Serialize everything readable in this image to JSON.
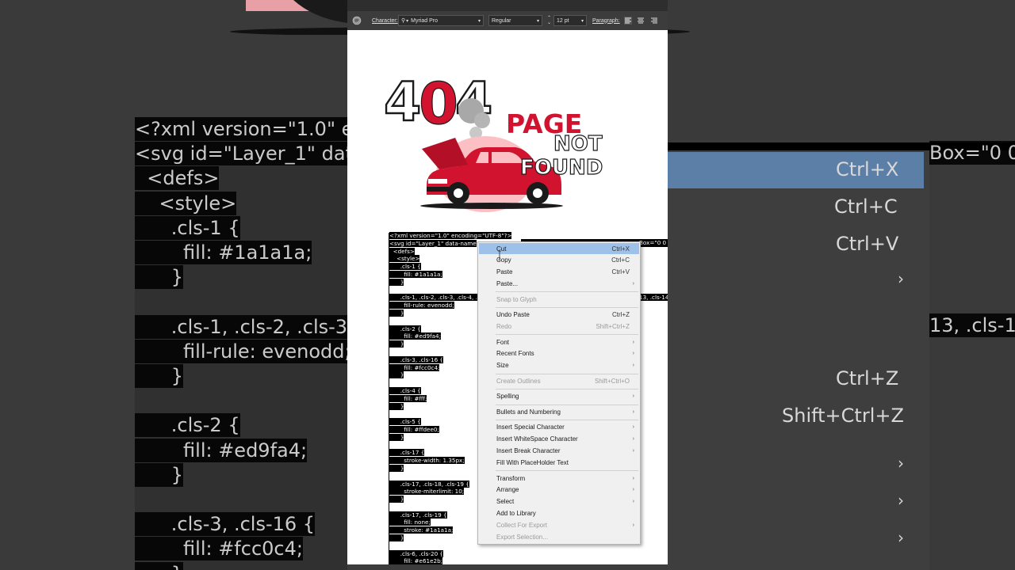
{
  "toolbar": {
    "character_label": "Character:",
    "font_family": "Myriad Pro",
    "font_style": "Regular",
    "font_size": "12 pt",
    "paragraph_label": "Paragraph:"
  },
  "artwork": {
    "number": "404",
    "line1": "PAGE",
    "line2": "NOT",
    "line3": "FOUND",
    "colors": {
      "red": "#d2132f",
      "dark": "#1a1a1a",
      "pink": "#fcc0c4",
      "smoke": "#a8a8a8"
    }
  },
  "code_lines": [
    "<?xml version=\"1.0\" encoding=\"UTF-8\"?>",
    "<svg id=\"Layer_1\" data-name",
    "  <defs>",
    "    <style>",
    "      .cls-1 {",
    "        fill: #1a1a1a;",
    "      }",
    "",
    "      .cls-1, .cls-2, .cls-3, .cls-4, .c",
    "        fill-rule: evenodd;",
    "      }",
    "",
    "      .cls-2 {",
    "        fill: #ed9fa4;",
    "      }",
    "",
    "      .cls-3, .cls-16 {",
    "        fill: #fcc0c4;",
    "      }",
    "",
    "      .cls-4 {",
    "        fill: #fff;",
    "      }",
    "",
    "      .cls-5 {",
    "        fill: #ffdee0;",
    "      }",
    "",
    "      .cls-17 {",
    "        stroke-width: 1.35px;",
    "      }",
    "",
    "      .cls-17, .cls-18, .cls-19 {",
    "        stroke-miterlimit: 10;",
    "      }",
    "",
    "      .cls-17, .cls-19 {",
    "        fill: none;",
    "        stroke: #1a1a1a;",
    "      }",
    "",
    "      .cls-6, .cls-20 {",
    "        fill: #e61e2b;"
  ],
  "code_right_fragments": {
    "line2_right": "Box=\"0 0",
    "line9_right": "13, .cls-14"
  },
  "context_menu": [
    {
      "label": "Cut",
      "shortcut": "Ctrl+X",
      "highlighted": true
    },
    {
      "label": "Copy",
      "shortcut": "Ctrl+C"
    },
    {
      "label": "Paste",
      "shortcut": "Ctrl+V"
    },
    {
      "label": "Paste...",
      "submenu": true
    },
    {
      "separator": true
    },
    {
      "label": "Snap to Glyph",
      "disabled": true
    },
    {
      "separator": true
    },
    {
      "label": "Undo Paste",
      "shortcut": "Ctrl+Z"
    },
    {
      "label": "Redo",
      "shortcut": "Shift+Ctrl+Z",
      "disabled": true
    },
    {
      "separator": true
    },
    {
      "label": "Font",
      "submenu": true
    },
    {
      "label": "Recent Fonts",
      "submenu": true
    },
    {
      "label": "Size",
      "submenu": true
    },
    {
      "separator": true
    },
    {
      "label": "Create Outlines",
      "shortcut": "Shift+Ctrl+O",
      "disabled": true
    },
    {
      "separator": true
    },
    {
      "label": "Spelling",
      "submenu": true
    },
    {
      "separator": true
    },
    {
      "label": "Bullets and Numbering",
      "submenu": true
    },
    {
      "separator": true
    },
    {
      "label": "Insert Special Character",
      "submenu": true
    },
    {
      "label": "Insert WhiteSpace Character",
      "submenu": true
    },
    {
      "label": "Insert Break Character",
      "submenu": true
    },
    {
      "label": "Fill With PlaceHolder Text"
    },
    {
      "separator": true
    },
    {
      "label": "Transform",
      "submenu": true
    },
    {
      "label": "Arrange",
      "submenu": true
    },
    {
      "label": "Select",
      "submenu": true
    },
    {
      "label": "Add to Library"
    },
    {
      "label": "Collect For Export",
      "submenu": true,
      "disabled": true
    },
    {
      "label": "Export Selection...",
      "disabled": true
    }
  ],
  "background_blur": {
    "code_lines": [
      "<?xml version=\"1.0\" en",
      "<svg id=\"Layer_1\" data",
      "  <defs>",
      "    <style>",
      "      .cls-1 {",
      "        fill: #1a1a1a;",
      "      }",
      "",
      "      .cls-1, .cls-2, .cls-3, .c",
      "        fill-rule: evenodd;",
      "      }",
      "",
      "      .cls-2 {",
      "        fill: #ed9fa4;",
      "      }",
      "",
      "      .cls-3, .cls-16 {",
      "        fill: #fcc0c4;",
      "      }"
    ],
    "shortcuts": [
      "Ctrl+X",
      "Ctrl+C",
      "Ctrl+V",
      "Ctrl+Z",
      "Shift+Ctrl+Z"
    ],
    "right_fragment_1": "Box=\"0 0",
    "right_fragment_2": "13, .cls-14"
  }
}
